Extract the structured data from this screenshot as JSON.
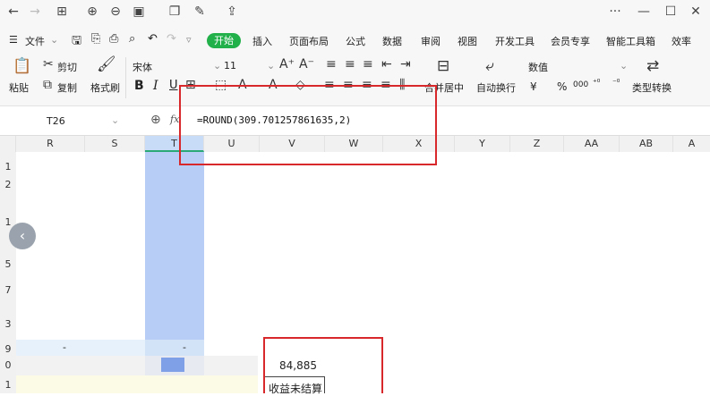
{
  "titlebar": {
    "left_icons": [
      "back-icon",
      "forward-icon",
      "grid-icon",
      "zoom-in-icon",
      "zoom-out-icon",
      "image-icon",
      "copy-icon",
      "edit-icon",
      "export-icon"
    ],
    "window_buttons": {
      "more": "···",
      "minimize": "—",
      "maximize": "☐",
      "close": "✕"
    }
  },
  "menu": {
    "file": "文件",
    "start": "开始",
    "tabs": [
      "插入",
      "页面布局",
      "公式",
      "数据",
      "审阅",
      "视图",
      "开发工具",
      "会员专享",
      "智能工具箱",
      "效率"
    ]
  },
  "ribbon": {
    "cut": "剪切",
    "paste": "粘贴",
    "copy": "复制",
    "format_painter": "格式刷",
    "font_name": "宋体",
    "font_size": "11",
    "bold": "B",
    "italic": "I",
    "underline": "U",
    "merge_center": "合并居中",
    "wrap_text": "自动换行",
    "number_format": "数值",
    "currency": "¥",
    "percent": "%",
    "thousands": "000",
    "type_convert": "类型转换"
  },
  "formula_bar": {
    "cell_ref": "T26",
    "fx": "fx",
    "formula": "=ROUND(309.701257861635,2)"
  },
  "columns": [
    "R",
    "S",
    "T",
    "U",
    "V",
    "W",
    "X",
    "Y",
    "Z",
    "AA",
    "AB",
    "A"
  ],
  "row_labels": [
    "1",
    "2",
    "1",
    "5",
    "7",
    "3",
    "9",
    "0",
    "1"
  ],
  "cells": {
    "dash_left": "-",
    "dash_mid": "-",
    "value_v": "84,885",
    "label_v": "收益未结算"
  },
  "colors": {
    "accent_green": "#22b04b",
    "highlight_red": "#d9282c",
    "selection_blue": "#b7cdf5"
  }
}
